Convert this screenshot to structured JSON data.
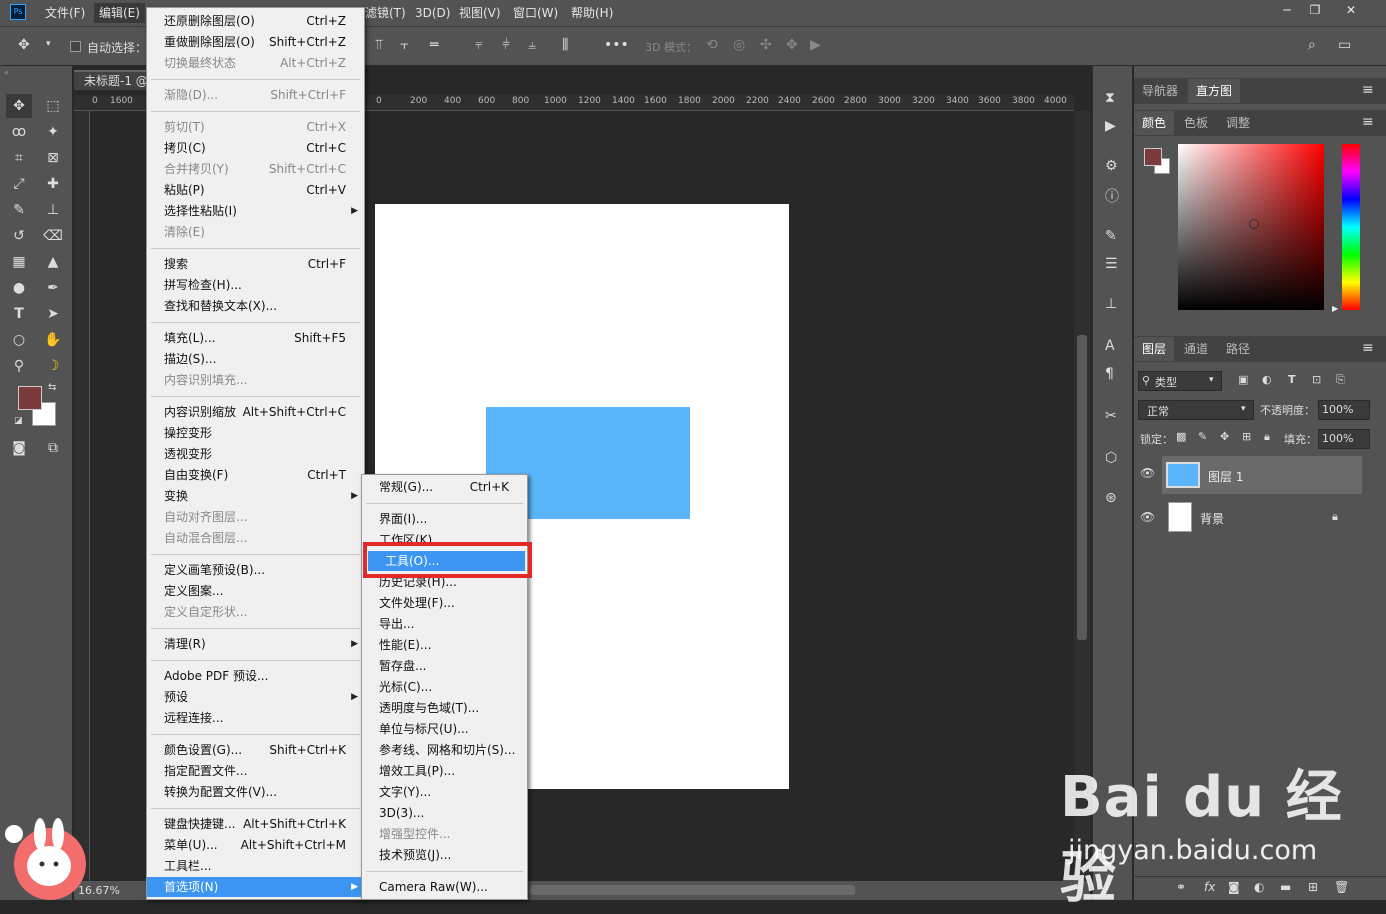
{
  "app": {
    "icon": "Ps"
  },
  "menubar": {
    "items": [
      "文件(F)",
      "编辑(E)",
      "滤镜(T)",
      "3D(D)",
      "视图(V)",
      "窗口(W)",
      "帮助(H)"
    ],
    "window_buttons": [
      "─",
      "❐",
      "✕"
    ]
  },
  "options": {
    "auto_select": "自动选择：",
    "mode3d": "3D 模式："
  },
  "document": {
    "tab_title": "未标题-1 @",
    "zoom": "16.67%",
    "ruler_ticks": [
      "0",
      "1600",
      "0",
      "200",
      "400",
      "600",
      "800",
      "1000",
      "1200",
      "1400",
      "1600",
      "1800",
      "2000",
      "2200",
      "2400",
      "2600",
      "2800",
      "3000",
      "3200",
      "3400",
      "3600",
      "3800",
      "4000"
    ]
  },
  "edit_menu": {
    "items": [
      {
        "label": "还原删除图层(O)",
        "shortcut": "Ctrl+Z",
        "disabled": false
      },
      {
        "label": "重做删除图层(O)",
        "shortcut": "Shift+Ctrl+Z",
        "disabled": false
      },
      {
        "label": "切换最终状态",
        "shortcut": "Alt+Ctrl+Z",
        "disabled": true
      },
      {
        "label": "渐隐(D)...",
        "shortcut": "Shift+Ctrl+F",
        "disabled": true
      },
      {
        "label": "剪切(T)",
        "shortcut": "Ctrl+X",
        "disabled": true
      },
      {
        "label": "拷贝(C)",
        "shortcut": "Ctrl+C",
        "disabled": false
      },
      {
        "label": "合并拷贝(Y)",
        "shortcut": "Shift+Ctrl+C",
        "disabled": true
      },
      {
        "label": "粘贴(P)",
        "shortcut": "Ctrl+V",
        "disabled": false
      },
      {
        "label": "选择性粘贴(I)",
        "shortcut": "",
        "disabled": false
      },
      {
        "label": "清除(E)",
        "shortcut": "",
        "disabled": true
      },
      {
        "label": "搜索",
        "shortcut": "Ctrl+F",
        "disabled": false
      },
      {
        "label": "拼写检查(H)...",
        "shortcut": "",
        "disabled": false
      },
      {
        "label": "查找和替换文本(X)...",
        "shortcut": "",
        "disabled": false
      },
      {
        "label": "填充(L)...",
        "shortcut": "Shift+F5",
        "disabled": false
      },
      {
        "label": "描边(S)...",
        "shortcut": "",
        "disabled": false
      },
      {
        "label": "内容识别填充...",
        "shortcut": "",
        "disabled": true
      },
      {
        "label": "内容识别缩放",
        "shortcut": "Alt+Shift+Ctrl+C",
        "disabled": false
      },
      {
        "label": "操控变形",
        "shortcut": "",
        "disabled": false
      },
      {
        "label": "透视变形",
        "shortcut": "",
        "disabled": false
      },
      {
        "label": "自由变换(F)",
        "shortcut": "Ctrl+T",
        "disabled": false
      },
      {
        "label": "变换",
        "shortcut": "",
        "disabled": false
      },
      {
        "label": "自动对齐图层...",
        "shortcut": "",
        "disabled": true
      },
      {
        "label": "自动混合图层...",
        "shortcut": "",
        "disabled": true
      },
      {
        "label": "定义画笔预设(B)...",
        "shortcut": "",
        "disabled": false
      },
      {
        "label": "定义图案...",
        "shortcut": "",
        "disabled": false
      },
      {
        "label": "定义自定形状...",
        "shortcut": "",
        "disabled": true
      },
      {
        "label": "清理(R)",
        "shortcut": "",
        "disabled": false
      },
      {
        "label": "Adobe PDF 预设...",
        "shortcut": "",
        "disabled": false
      },
      {
        "label": "预设",
        "shortcut": "",
        "disabled": false
      },
      {
        "label": "远程连接...",
        "shortcut": "",
        "disabled": false
      },
      {
        "label": "颜色设置(G)...",
        "shortcut": "Shift+Ctrl+K",
        "disabled": false
      },
      {
        "label": "指定配置文件...",
        "shortcut": "",
        "disabled": false
      },
      {
        "label": "转换为配置文件(V)...",
        "shortcut": "",
        "disabled": false
      },
      {
        "label": "键盘快捷键...",
        "shortcut": "Alt+Shift+Ctrl+K",
        "disabled": false
      },
      {
        "label": "菜单(U)...",
        "shortcut": "Alt+Shift+Ctrl+M",
        "disabled": false
      },
      {
        "label": "工具栏...",
        "shortcut": "",
        "disabled": false
      },
      {
        "label": "首选项(N)",
        "shortcut": "",
        "disabled": false
      }
    ]
  },
  "prefs_menu": {
    "items": [
      {
        "label": "常规(G)...",
        "shortcut": "Ctrl+K",
        "disabled": false
      },
      {
        "label": "界面(I)...",
        "shortcut": "",
        "disabled": false
      },
      {
        "label": "工作区(K)...",
        "shortcut": "",
        "disabled": false
      },
      {
        "label": "工具(O)...",
        "shortcut": "",
        "disabled": false
      },
      {
        "label": "历史记录(H)...",
        "shortcut": "",
        "disabled": false
      },
      {
        "label": "文件处理(F)...",
        "shortcut": "",
        "disabled": false
      },
      {
        "label": "导出...",
        "shortcut": "",
        "disabled": false
      },
      {
        "label": "性能(E)...",
        "shortcut": "",
        "disabled": false
      },
      {
        "label": "暂存盘...",
        "shortcut": "",
        "disabled": false
      },
      {
        "label": "光标(C)...",
        "shortcut": "",
        "disabled": false
      },
      {
        "label": "透明度与色域(T)...",
        "shortcut": "",
        "disabled": false
      },
      {
        "label": "单位与标尺(U)...",
        "shortcut": "",
        "disabled": false
      },
      {
        "label": "参考线、网格和切片(S)...",
        "shortcut": "",
        "disabled": false
      },
      {
        "label": "增效工具(P)...",
        "shortcut": "",
        "disabled": false
      },
      {
        "label": "文字(Y)...",
        "shortcut": "",
        "disabled": false
      },
      {
        "label": "3D(3)...",
        "shortcut": "",
        "disabled": false
      },
      {
        "label": "增强型控件...",
        "shortcut": "",
        "disabled": true
      },
      {
        "label": "技术预览(J)...",
        "shortcut": "",
        "disabled": false
      },
      {
        "label": "Camera Raw(W)...",
        "shortcut": "",
        "disabled": false
      }
    ]
  },
  "panels": {
    "top_tabs": [
      "导航器",
      "直方图"
    ],
    "color_tabs": [
      "颜色",
      "色板",
      "调整"
    ],
    "layer_tabs": [
      "图层",
      "通道",
      "路径"
    ],
    "filter_kind": "类型",
    "blend_mode": "正常",
    "opacity_label": "不透明度：",
    "opacity_value": "100%",
    "lock_label": "锁定：",
    "fill_label": "填充：",
    "fill_value": "100%",
    "layers": [
      {
        "name": "图层 1",
        "locked": false
      },
      {
        "name": "背景",
        "locked": true
      }
    ]
  },
  "colors": {
    "foreground": "#7b3a3c",
    "background": "#ffffff",
    "layer_fill": "#5ab5fa"
  },
  "watermark": {
    "logo": "Bai du 经验",
    "url": "jingyan.baidu.com"
  }
}
